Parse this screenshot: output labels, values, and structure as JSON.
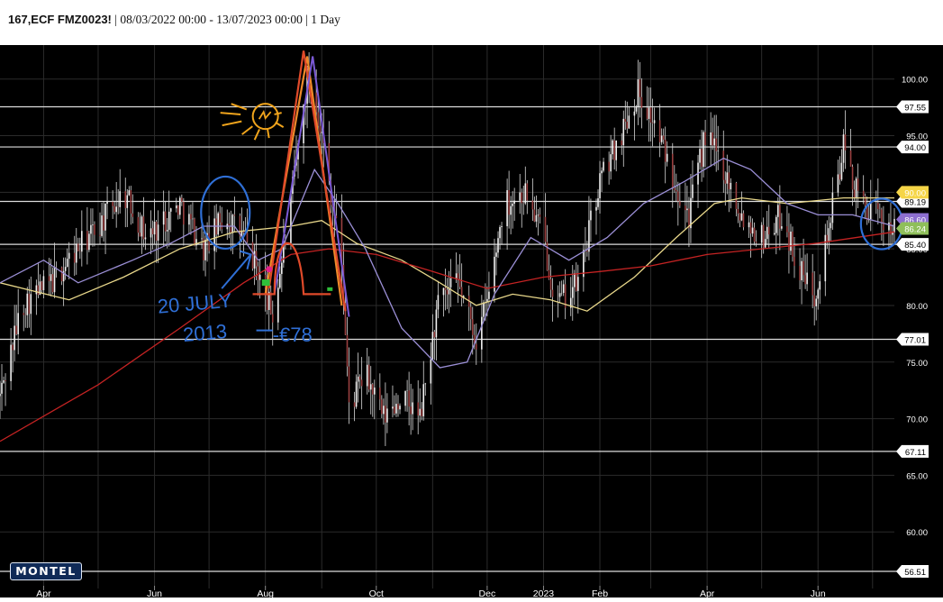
{
  "header": {
    "symbol": "167,ECF FMZ0023!",
    "details": " | 08/03/2022 00:00 - 13/07/2023 00:00 | 1 Day"
  },
  "logo": "MONTEL",
  "colors": {
    "background": "#000000",
    "grid": "#2b2b2b",
    "bars": "#d8d8d8",
    "ma_yellow": "#e8d78a",
    "ma_red": "#c42323",
    "ma_purple": "#9b8fd6",
    "hline": "#dcdcdc",
    "annot_blue": "#2f6fd6",
    "annot_orange": "#f0a41c",
    "annot_red": "#e04a2a",
    "annot_purple": "#7b5ad6"
  },
  "chart_data": {
    "type": "candlestick",
    "x_range": [
      "2022-03-08",
      "2023-07-13"
    ],
    "interval": "1 Day",
    "x_tick_labels": [
      "Apr",
      "Jun",
      "Aug",
      "Oct",
      "Dec",
      "2023",
      "Feb",
      "Apr",
      "Jun"
    ],
    "y_range": [
      55,
      103
    ],
    "y_tick_labels": [
      "100.00",
      "95.00",
      "90.00",
      "85.00",
      "80.00",
      "75.00",
      "70.00",
      "65.00",
      "60.00"
    ],
    "y_ticks": [
      100,
      95,
      90,
      85,
      80,
      75,
      70,
      65,
      60
    ],
    "horizontal_levels": [
      {
        "value": 97.55,
        "label": "97.55",
        "style": "white"
      },
      {
        "value": 94.0,
        "label": "94.00",
        "style": "white"
      },
      {
        "value": 89.19,
        "label": "89.19",
        "style": "white"
      },
      {
        "value": 85.4,
        "label": "85.40",
        "style": "white"
      },
      {
        "value": 77.01,
        "label": "77.01",
        "style": "white"
      },
      {
        "value": 67.11,
        "label": "67.11",
        "style": "white"
      },
      {
        "value": 56.51,
        "label": "56.51",
        "style": "white"
      }
    ],
    "current_markers": [
      {
        "value": 90.0,
        "label": "90.00",
        "color": "#f5d547"
      },
      {
        "value": 87.6,
        "label": "86.60",
        "color": "#8d6fd0"
      },
      {
        "value": 86.8,
        "label": "86.24",
        "color": "#8fbf5a"
      }
    ],
    "price_path": [
      [
        "2022-03-08",
        72
      ],
      [
        "2022-03-20",
        80
      ],
      [
        "2022-04-05",
        82
      ],
      [
        "2022-04-20",
        85
      ],
      [
        "2022-05-01",
        87
      ],
      [
        "2022-05-15",
        90
      ],
      [
        "2022-05-28",
        86
      ],
      [
        "2022-06-15",
        89
      ],
      [
        "2022-06-28",
        85
      ],
      [
        "2022-07-10",
        88
      ],
      [
        "2022-07-20",
        86
      ],
      [
        "2022-07-28",
        83
      ],
      [
        "2022-08-05",
        79
      ],
      [
        "2022-08-15",
        89
      ],
      [
        "2022-08-24",
        100
      ],
      [
        "2022-08-29",
        98
      ],
      [
        "2022-09-05",
        91
      ],
      [
        "2022-09-12",
        84
      ],
      [
        "2022-09-16",
        71
      ],
      [
        "2022-09-25",
        74
      ],
      [
        "2022-10-05",
        70
      ],
      [
        "2022-10-15",
        72
      ],
      [
        "2022-10-25",
        70
      ],
      [
        "2022-11-04",
        80
      ],
      [
        "2022-11-15",
        82
      ],
      [
        "2022-11-25",
        77
      ],
      [
        "2022-12-02",
        81
      ],
      [
        "2022-12-10",
        89
      ],
      [
        "2022-12-22",
        90
      ],
      [
        "2023-01-01",
        86
      ],
      [
        "2023-01-08",
        80
      ],
      [
        "2023-01-20",
        82
      ],
      [
        "2023-02-01",
        91
      ],
      [
        "2023-02-12",
        95
      ],
      [
        "2023-02-22",
        99
      ],
      [
        "2023-03-03",
        96
      ],
      [
        "2023-03-12",
        92
      ],
      [
        "2023-03-22",
        88
      ],
      [
        "2023-03-31",
        95
      ],
      [
        "2023-04-08",
        93
      ],
      [
        "2023-04-20",
        88
      ],
      [
        "2023-05-01",
        86
      ],
      [
        "2023-05-12",
        88
      ],
      [
        "2023-05-22",
        83
      ],
      [
        "2023-05-30",
        81
      ],
      [
        "2023-06-07",
        87
      ],
      [
        "2023-06-15",
        94
      ],
      [
        "2023-06-22",
        90
      ],
      [
        "2023-07-01",
        88
      ],
      [
        "2023-07-13",
        87
      ]
    ],
    "moving_averages": [
      {
        "color": "#e8d78a",
        "points": [
          [
            "2022-03-08",
            82
          ],
          [
            "2022-04-15",
            80.5
          ],
          [
            "2022-05-15",
            82.5
          ],
          [
            "2022-06-15",
            85
          ],
          [
            "2022-07-15",
            86.5
          ],
          [
            "2022-08-15",
            87
          ],
          [
            "2022-09-01",
            87.5
          ],
          [
            "2022-09-20",
            85.5
          ],
          [
            "2022-10-15",
            84
          ],
          [
            "2022-11-05",
            82
          ],
          [
            "2022-11-25",
            80
          ],
          [
            "2022-12-15",
            81
          ],
          [
            "2023-01-05",
            80.5
          ],
          [
            "2023-01-25",
            79.5
          ],
          [
            "2023-02-20",
            82.5
          ],
          [
            "2023-03-15",
            86
          ],
          [
            "2023-04-05",
            89
          ],
          [
            "2023-04-20",
            89.5
          ],
          [
            "2023-05-15",
            89
          ],
          [
            "2023-06-15",
            89.5
          ],
          [
            "2023-07-13",
            89.5
          ]
        ]
      },
      {
        "color": "#c42323",
        "points": [
          [
            "2022-03-08",
            68
          ],
          [
            "2022-05-01",
            73
          ],
          [
            "2022-06-15",
            78
          ],
          [
            "2022-07-20",
            82
          ],
          [
            "2022-08-15",
            84.5
          ],
          [
            "2022-09-05",
            85
          ],
          [
            "2022-10-01",
            84.5
          ],
          [
            "2022-11-01",
            83
          ],
          [
            "2022-12-01",
            81.5
          ],
          [
            "2023-01-01",
            82.5
          ],
          [
            "2023-02-01",
            83
          ],
          [
            "2023-03-01",
            83.5
          ],
          [
            "2023-04-01",
            84.5
          ],
          [
            "2023-05-01",
            85
          ],
          [
            "2023-06-01",
            85.5
          ],
          [
            "2023-07-13",
            86.5
          ]
        ]
      },
      {
        "color": "#9b8fd6",
        "points": [
          [
            "2022-03-08",
            82
          ],
          [
            "2022-04-01",
            84
          ],
          [
            "2022-04-20",
            82
          ],
          [
            "2022-05-20",
            84
          ],
          [
            "2022-06-10",
            85.5
          ],
          [
            "2022-06-28",
            87
          ],
          [
            "2022-07-15",
            87
          ],
          [
            "2022-07-28",
            84
          ],
          [
            "2022-08-10",
            85
          ],
          [
            "2022-08-28",
            92
          ],
          [
            "2022-09-10",
            89
          ],
          [
            "2022-09-25",
            85
          ],
          [
            "2022-10-15",
            78
          ],
          [
            "2022-11-05",
            74.5
          ],
          [
            "2022-11-20",
            75
          ],
          [
            "2022-12-05",
            81
          ],
          [
            "2022-12-25",
            86
          ],
          [
            "2023-01-15",
            84
          ],
          [
            "2023-02-05",
            86
          ],
          [
            "2023-02-25",
            89
          ],
          [
            "2023-03-20",
            91
          ],
          [
            "2023-04-10",
            93
          ],
          [
            "2023-04-25",
            92
          ],
          [
            "2023-05-15",
            89
          ],
          [
            "2023-06-01",
            88
          ],
          [
            "2023-06-20",
            88
          ],
          [
            "2023-07-13",
            87
          ]
        ]
      }
    ],
    "annotations": [
      {
        "type": "text",
        "text": "20 JULY",
        "color": "#2f6fd6"
      },
      {
        "type": "text",
        "text": "2013",
        "color": "#2f6fd6"
      },
      {
        "type": "text",
        "text": "-€78",
        "color": "#2f6fd6"
      }
    ]
  }
}
